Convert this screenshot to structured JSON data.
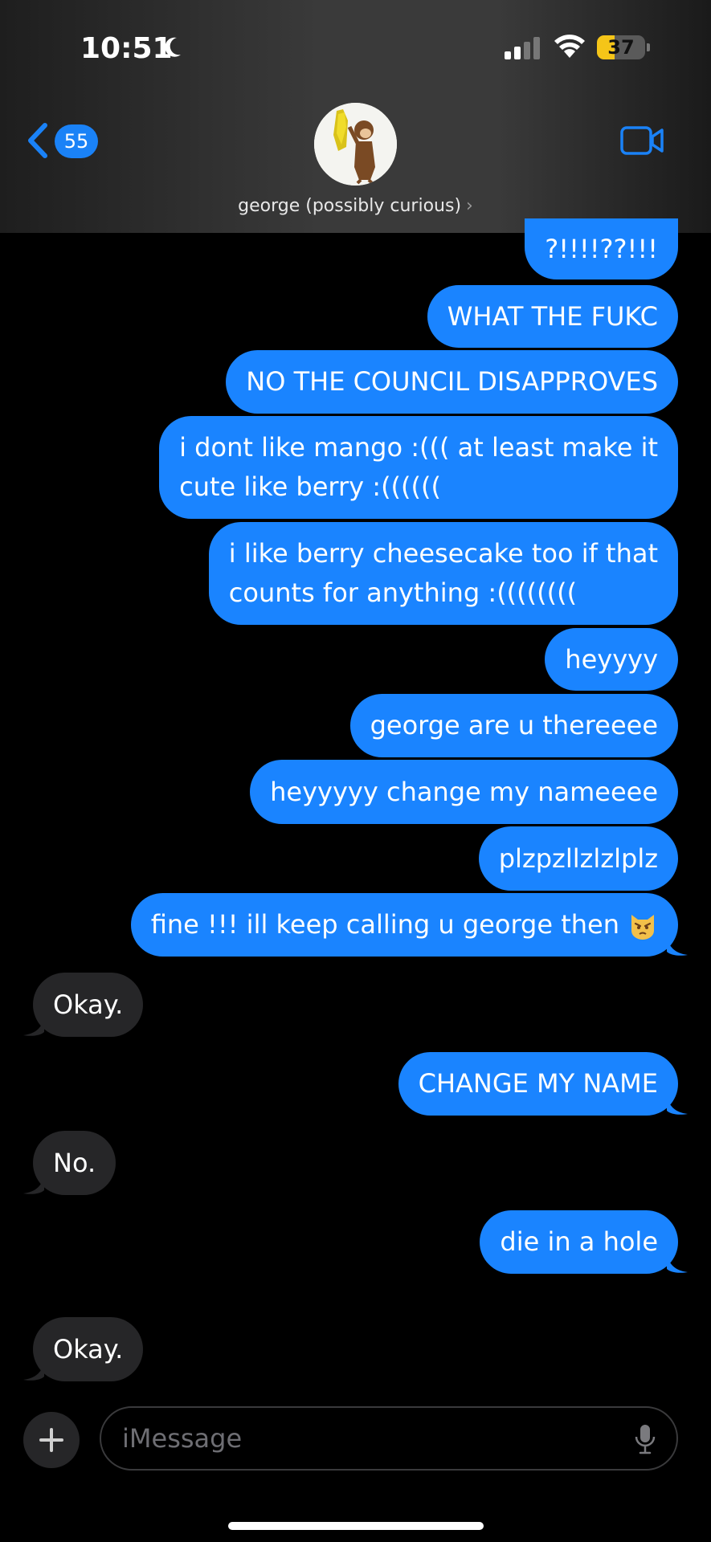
{
  "status_bar": {
    "time": "10:51",
    "battery": "37",
    "battery_level": 0.37,
    "battery_color": "#f5c518"
  },
  "header": {
    "back_badge": "55",
    "contact_name": "george (possibly curious)",
    "contact_chevron": "›",
    "avatar_icon": "curious-george-avatar",
    "video_icon": "video-camera-icon"
  },
  "messages": [
    {
      "side": "sent",
      "text": "?!!!!??!!!"
    },
    {
      "side": "sent",
      "text": "WHAT THE FUKC"
    },
    {
      "side": "sent",
      "text": "NO THE COUNCIL DISAPPROVES"
    },
    {
      "side": "sent",
      "lines": [
        "i dont like mango :((( at least make it",
        "cute like berry :(((((("
      ]
    },
    {
      "side": "sent",
      "lines": [
        "i like berry cheesecake too if that",
        "counts for anything :(((((((("
      ]
    },
    {
      "side": "sent",
      "text": "heyyyy"
    },
    {
      "side": "sent",
      "text": "george are u thereeee"
    },
    {
      "side": "sent",
      "text": "heyyyyy change my nameeee"
    },
    {
      "side": "sent",
      "text": "plzpzllzlzlplz"
    },
    {
      "side": "sent",
      "text": "fine !!! ill keep calling u george then",
      "emoji": "pouting-cat-emoji"
    },
    {
      "side": "received",
      "text": "Okay."
    },
    {
      "side": "sent",
      "text": "CHANGE MY NAME"
    },
    {
      "side": "received",
      "text": "No."
    },
    {
      "side": "sent",
      "text": "die in a hole"
    },
    {
      "side": "received",
      "text": "Okay."
    }
  ],
  "composer": {
    "placeholder": "iMessage",
    "plus_icon": "plus-icon",
    "mic_icon": "microphone-icon"
  },
  "colors": {
    "sent_bubble": "#1a84ff",
    "received_bubble": "#262628",
    "accent": "#1a82f7"
  }
}
